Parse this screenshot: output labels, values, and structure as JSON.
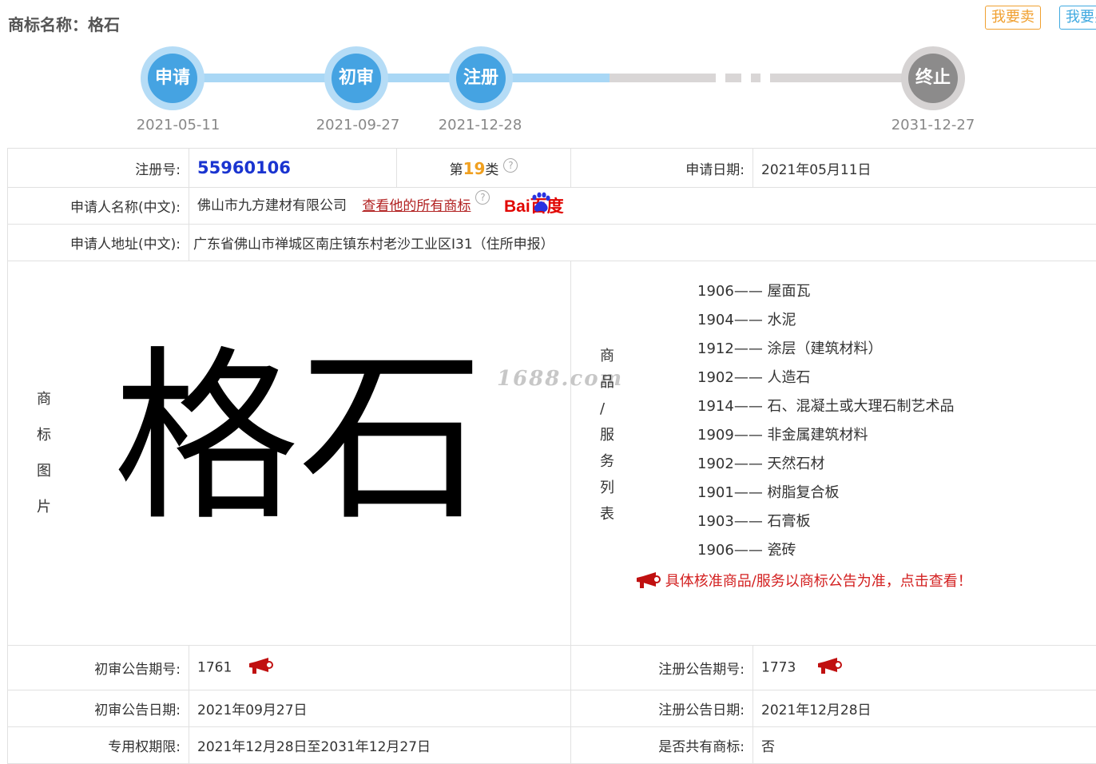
{
  "header": {
    "title": "商标名称：格石",
    "sell_button": "我要卖",
    "buy_button": "我要买"
  },
  "timeline": [
    {
      "label": "申请",
      "date": "2021-05-11",
      "status": "done"
    },
    {
      "label": "初审",
      "date": "2021-09-27",
      "status": "done"
    },
    {
      "label": "注册",
      "date": "2021-12-28",
      "status": "done"
    },
    {
      "label": "终止",
      "date": "2031-12-27",
      "status": "pending"
    }
  ],
  "info": {
    "reg_no_label": "注册号:",
    "reg_no": "55960106",
    "class_prefix": "第",
    "class_num": "19",
    "class_suffix": "类",
    "apply_date_label": "申请日期:",
    "apply_date": "2021年05月11日",
    "applicant_label": "申请人名称(中文):",
    "applicant": "佛山市九方建材有限公司",
    "applicant_link": "查看他的所有商标",
    "baidu_brand": "Bai百度",
    "address_label": "申请人地址(中文):",
    "address": "广东省佛山市禅城区南庄镇东村老沙工业区I31（住所申报）",
    "image_label": [
      "商",
      "标",
      "图",
      "片"
    ],
    "trademark_text": "格石",
    "watermark": "1688.com",
    "goods_label": [
      "商",
      "品",
      "/",
      "服",
      "务",
      "列",
      "表"
    ],
    "goods": [
      {
        "code": "1906",
        "name": "屋面瓦"
      },
      {
        "code": "1904",
        "name": "水泥"
      },
      {
        "code": "1912",
        "name": "涂层（建筑材料）"
      },
      {
        "code": "1902",
        "name": "人造石"
      },
      {
        "code": "1914",
        "name": "石、混凝土或大理石制艺术品"
      },
      {
        "code": "1909",
        "name": "非金属建筑材料"
      },
      {
        "code": "1902",
        "name": "天然石材"
      },
      {
        "code": "1901",
        "name": "树脂复合板"
      },
      {
        "code": "1903",
        "name": "石膏板"
      },
      {
        "code": "1906",
        "name": "瓷砖"
      }
    ],
    "goods_separator": "——",
    "goods_note": "具体核准商品/服务以商标公告为准，点击查看！",
    "prelim_no_label": "初审公告期号:",
    "prelim_no": "1761",
    "reg_ann_no_label": "注册公告期号:",
    "reg_ann_no": "1773",
    "prelim_date_label": "初审公告日期:",
    "prelim_date": "2021年09月27日",
    "reg_ann_date_label": "注册公告日期:",
    "reg_ann_date": "2021年12月28日",
    "exclusive_label": "专用权期限:",
    "exclusive_period": "2021年12月28日至2031年12月27日",
    "shared_label": "是否共有商标:",
    "shared": "否"
  },
  "colors": {
    "progress_done": "#45a3e2",
    "progress_pending": "#8c8b8b",
    "reg_no": "#1a34d0",
    "class_num": "#f0a020",
    "note": "#d32020"
  }
}
